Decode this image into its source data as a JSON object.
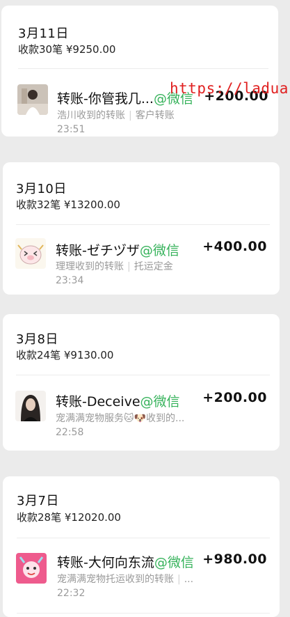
{
  "watermark": "https://ladua.",
  "cards": [
    {
      "date": "3月11日",
      "summary": "收款30笔 ¥9250.00",
      "tx": {
        "title": "转账-你管我几...",
        "tag": "@微信",
        "amount": "+200.00",
        "receiver": "浩川收到的转账",
        "category": "客户转账",
        "time": "23:51",
        "avatar_icon": "girl-photo-avatar"
      }
    },
    {
      "date": "3月10日",
      "summary": "收款32笔 ¥13200.00",
      "tx": {
        "title": "转账-ゼチヅザ",
        "tag": "@微信",
        "amount": "+400.00",
        "receiver": "理理收到的转账",
        "category": "托运定金",
        "time": "23:34",
        "avatar_icon": "cartoon-pig-avatar"
      }
    },
    {
      "date": "3月8日",
      "summary": "收款24笔 ¥9130.00",
      "tx": {
        "title": "转账-Deceive",
        "tag": "@微信",
        "amount": "+200.00",
        "receiver": "宠满满宠物服务🐱🐶收到的...",
        "category": "",
        "time": "22:58",
        "avatar_icon": "woman-portrait-avatar"
      }
    },
    {
      "date": "3月7日",
      "summary": "收款28笔 ¥12020.00",
      "tx": {
        "title": "转账-大何向东流",
        "tag": "@微信",
        "amount": "+980.00",
        "receiver": "宠满满宠物托运收到的转账",
        "category": "...",
        "time": "22:32",
        "avatar_icon": "pink-cartoon-avatar"
      }
    }
  ],
  "colors": {
    "page_bg": "#ebebeb",
    "card_bg": "#ffffff",
    "wechat_green": "#35b25a",
    "watermark_red": "#e02020",
    "muted_text": "#9a9a9a"
  }
}
